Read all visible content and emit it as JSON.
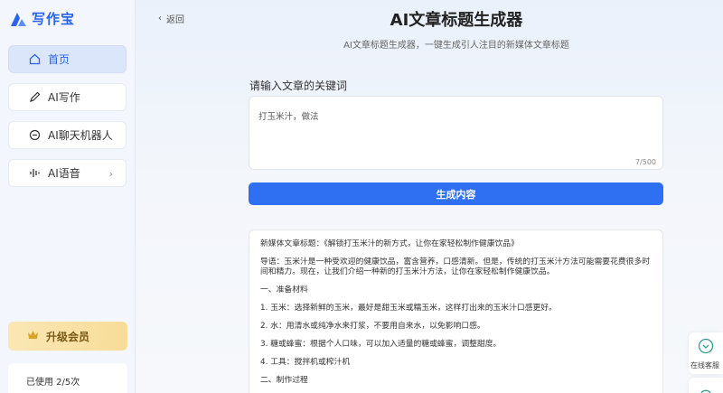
{
  "app": {
    "logo_text": "写作宝"
  },
  "sidebar": {
    "items": [
      {
        "label": "首页",
        "icon": "home-icon"
      },
      {
        "label": "AI写作",
        "icon": "pen-icon"
      },
      {
        "label": "AI聊天机器人",
        "icon": "chat-icon"
      },
      {
        "label": "AI语音",
        "icon": "voice-icon"
      }
    ],
    "upgrade_label": "升级会员",
    "usage_text": "已使用 2/5次"
  },
  "header": {
    "back_label": "返回",
    "title": "AI文章标题生成器",
    "subtitle": "AI文章标题生成器，一键生成引人注目的新媒体文章标题"
  },
  "form": {
    "input_label": "请输入文章的关键词",
    "input_value": "打玉米汁，做法",
    "char_count": "7/500",
    "generate_label": "生成内容"
  },
  "result": {
    "paragraphs": [
      "新媒体文章标题：《解锁打玉米汁的新方式，让你在家轻松制作健康饮品》",
      "导语：玉米汁是一种受欢迎的健康饮品，富含营养，口感清新。但是，传统的打玉米汁方法可能需要花费很多时间和精力。现在，让我们介绍一种新的打玉米汁方法，让你在家轻松制作健康饮品。",
      "一、准备材料",
      "1. 玉米：选择新鲜的玉米，最好是甜玉米或糯玉米，这样打出来的玉米汁口感更好。",
      "2. 水：用清水或纯净水来打浆，不要用自来水，以免影响口感。",
      "3. 糖或蜂蜜：根据个人口味，可以加入适量的糖或蜂蜜，调整甜度。",
      "4. 工具：搅拌机或榨汁机",
      "二、制作过程"
    ]
  },
  "widget": {
    "customer_service_label": "在线客服"
  },
  "colors": {
    "accent": "#2f6ff2",
    "brand": "#2b64e6",
    "upgrade": "#f8dc98"
  }
}
